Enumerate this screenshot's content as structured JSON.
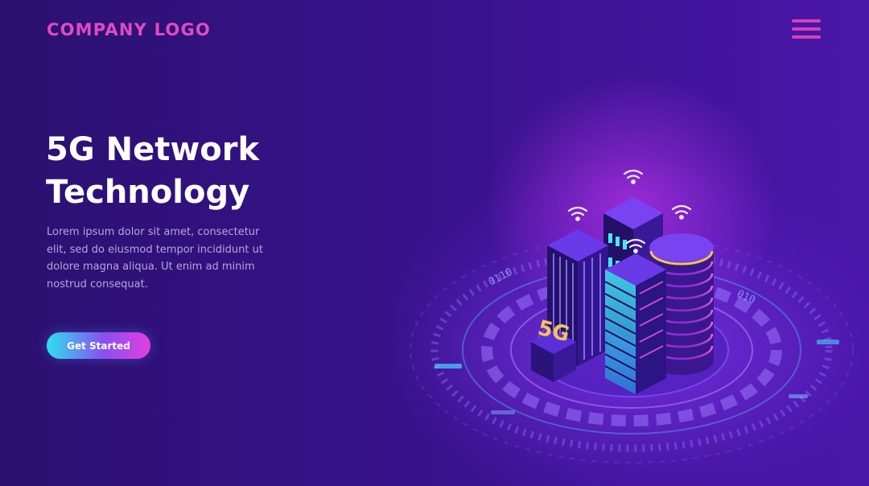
{
  "header": {
    "logo_text": "COMPANY LOGO",
    "menu_icon": "hamburger-menu-icon"
  },
  "hero": {
    "title_line1": "5G Network",
    "title_line2": "Technology",
    "body": "Lorem ipsum dolor sit amet, consectetur elit, sed do eiusmod tempor incididunt ut dolore magna aliqua. Ut enim ad minim nostrud consequat.",
    "cta_label": "Get Started"
  },
  "illustration": {
    "badge_text": "5G",
    "binary_text_1": "0110",
    "binary_text_2": "010",
    "icon": "wifi-signal-icon"
  },
  "colors": {
    "background": "#2b1170",
    "logo": "#e04bc0",
    "menu": "#d63fb5",
    "title": "#ffffff",
    "body_text": "#b5a6dc",
    "cta_start": "#2ee0f0",
    "cta_end": "#e23fe0",
    "neon_cyan": "#39e6f2",
    "neon_pink": "#f25ad8",
    "badge": "#f4c15a"
  }
}
